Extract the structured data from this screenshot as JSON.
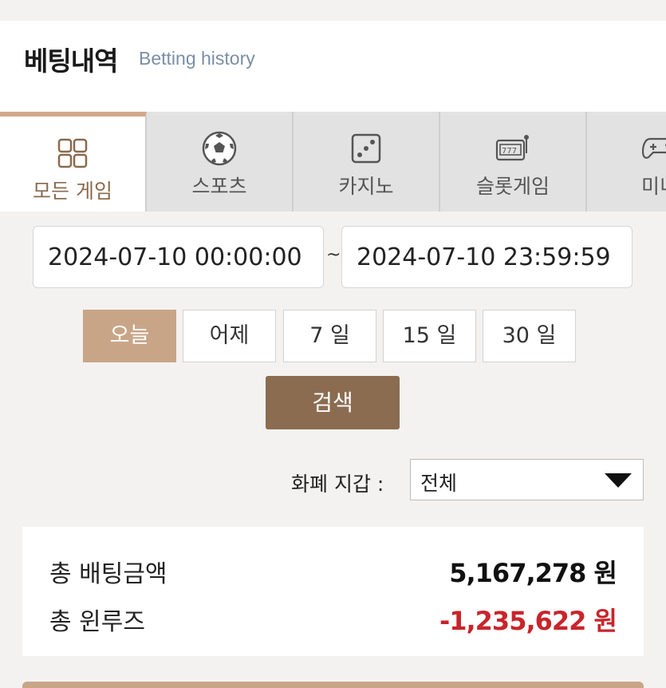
{
  "header": {
    "title_ko": "베팅내역",
    "title_en": "Betting history"
  },
  "tabs": [
    {
      "label": "모든 게임",
      "icon": "grid-icon",
      "active": true
    },
    {
      "label": "스포츠",
      "icon": "soccer-ball-icon",
      "active": false
    },
    {
      "label": "카지노",
      "icon": "dice-icon",
      "active": false
    },
    {
      "label": "슬롯게임",
      "icon": "slot-machine-icon",
      "active": false
    },
    {
      "label": "미니",
      "icon": "gamepad-icon",
      "active": false
    }
  ],
  "date_range": {
    "start": "2024-07-10 00:00:00",
    "separator": "~",
    "end": "2024-07-10 23:59:59"
  },
  "periods": [
    {
      "label": "오늘",
      "active": true
    },
    {
      "label": "어제",
      "active": false
    },
    {
      "label": "7 일",
      "active": false
    },
    {
      "label": "15 일",
      "active": false
    },
    {
      "label": "30 일",
      "active": false
    }
  ],
  "search": {
    "label": "검색"
  },
  "wallet": {
    "label": "화폐 지갑 :",
    "selected": "전체"
  },
  "summary": {
    "total_bet_label": "총 배팅금액",
    "total_bet_value": "5,167,278 원",
    "total_winloss_label": "총 윈루즈",
    "total_winloss_value": "-1,235,622 원"
  },
  "colors": {
    "accent": "#c9a587",
    "search_button": "#8b6c51",
    "negative": "#c8252b",
    "active_tab_label": "#8a6a4e"
  }
}
